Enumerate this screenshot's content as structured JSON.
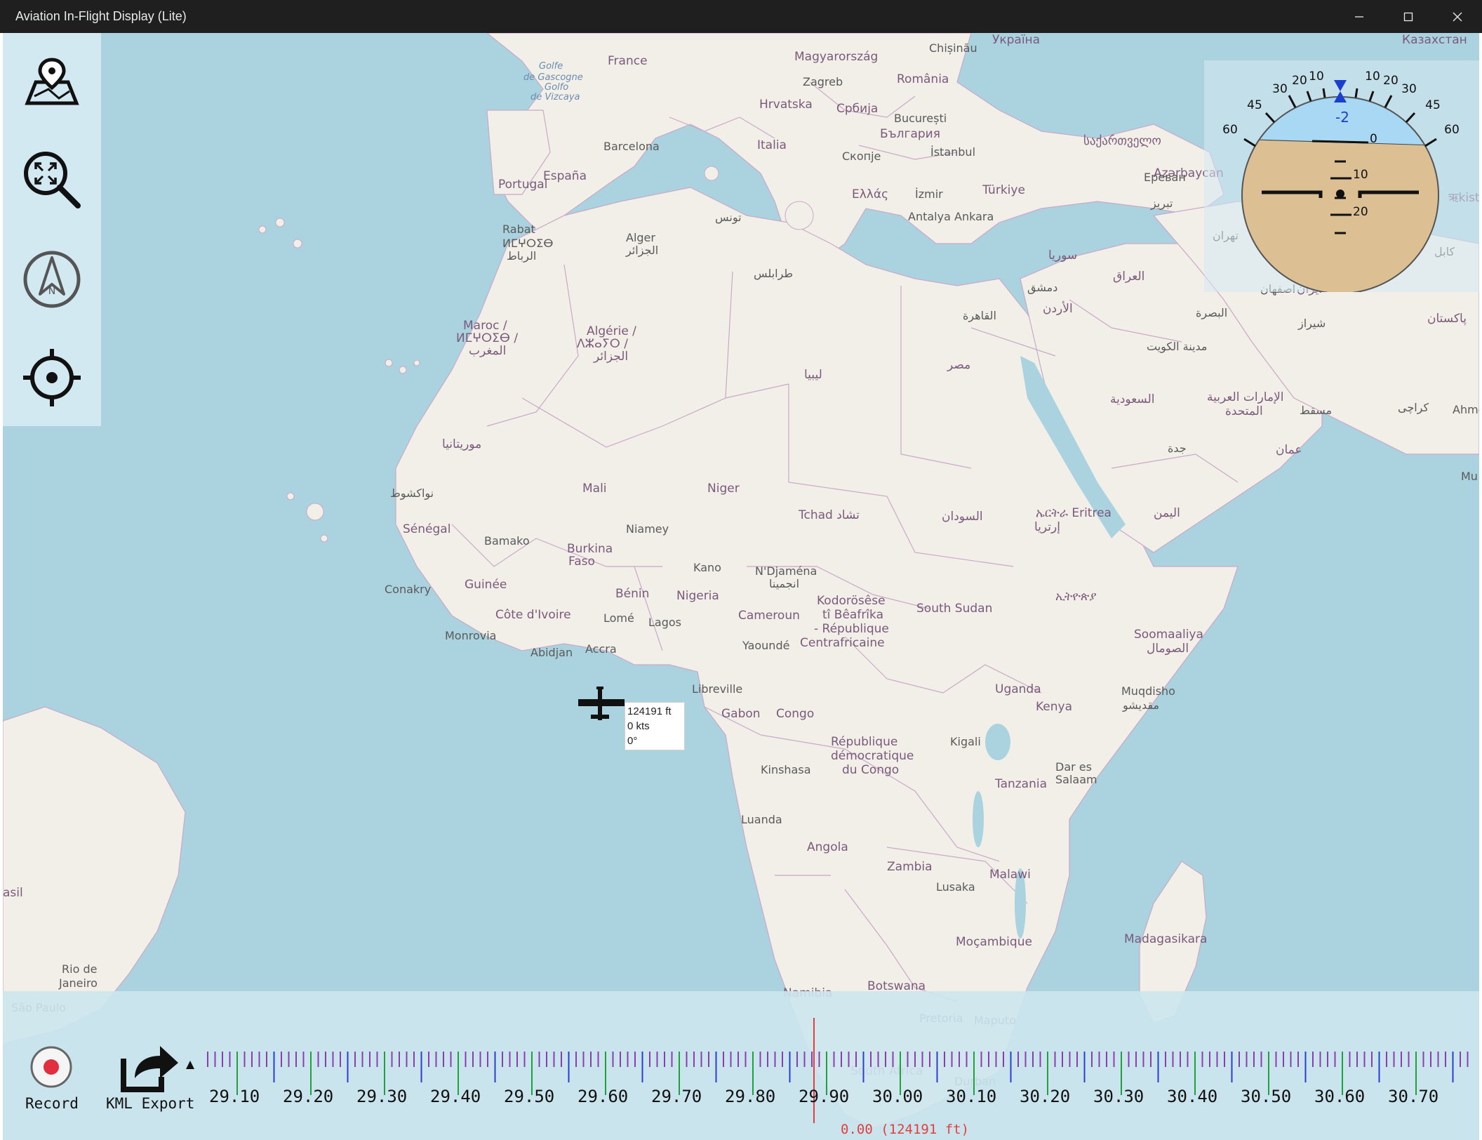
{
  "window": {
    "title": "Aviation In-Flight Display (Lite)",
    "controls": [
      "minimize-icon",
      "maximize-icon",
      "close-icon"
    ]
  },
  "toolbar": {
    "tools": [
      {
        "name": "map-pin-icon"
      },
      {
        "name": "zoom-fit-icon"
      },
      {
        "name": "north-up-icon"
      },
      {
        "name": "center-location-icon"
      }
    ]
  },
  "attitude": {
    "bank_scale": [
      "60",
      "45",
      "30",
      "20",
      "10",
      "10",
      "20",
      "30",
      "45",
      "60"
    ],
    "roll_readout": "-2",
    "pitch_labels": [
      "0",
      "10",
      "20"
    ],
    "sky_color": "#a9d8f5",
    "ground_color": "#ddbf94"
  },
  "aircraft": {
    "altitude": "124191 ft",
    "speed": "0 kts",
    "heading": "0°"
  },
  "bottom": {
    "record_label": "Record",
    "kml_label": "KML Export",
    "timeline_labels": [
      "29.10",
      "29.20",
      "29.30",
      "29.40",
      "29.50",
      "29.60",
      "29.70",
      "29.80",
      "29.90",
      "30.00",
      "30.10",
      "30.20",
      "30.30",
      "30.40",
      "30.50",
      "30.60",
      "30.70"
    ],
    "current_readout": "0.00 (124191 ft)",
    "record_color": "#e03040",
    "cursor_color": "#e04040"
  },
  "map": {
    "places": [
      {
        "t": "France"
      },
      {
        "t": "Magyarország"
      },
      {
        "t": "România"
      },
      {
        "t": "Zagreb"
      },
      {
        "t": "Chișinău"
      },
      {
        "t": "Україна"
      },
      {
        "t": "Hrvatska"
      },
      {
        "t": "Србија"
      },
      {
        "t": "București"
      },
      {
        "t": "България"
      },
      {
        "t": "Italia"
      },
      {
        "t": "Barcelona"
      },
      {
        "t": "Portugal"
      },
      {
        "t": "España"
      },
      {
        "t": "Скопје"
      },
      {
        "t": "İstanbul"
      },
      {
        "t": "საქართველო"
      },
      {
        "t": "Ελλάς"
      },
      {
        "t": "İzmir"
      },
      {
        "t": "Türkiye"
      },
      {
        "t": "Ankara"
      },
      {
        "t": "Azərbaycan"
      },
      {
        "t": "Antalya"
      },
      {
        "t": "Rabat"
      },
      {
        "t": "ⵍⵎⵖⵔⵉⴱ"
      },
      {
        "t": "الرباط"
      },
      {
        "t": "Alger"
      },
      {
        "t": "الجزائر"
      },
      {
        "t": "تونس"
      },
      {
        "t": "طرابلس"
      },
      {
        "t": "Maroc /"
      },
      {
        "t": "ⵍⵎⵖⵔⵉⴱ /"
      },
      {
        "t": "المغرب"
      },
      {
        "t": "Algérie /"
      },
      {
        "t": "ⴷⵣⴰⵢⵔ /"
      },
      {
        "t": "الجزائر"
      },
      {
        "t": "سوريا"
      },
      {
        "t": "دمشق"
      },
      {
        "t": "العراق"
      },
      {
        "t": "الأردن"
      },
      {
        "t": "القاهرة"
      },
      {
        "t": "مصر"
      },
      {
        "t": "ليبيا"
      },
      {
        "t": "موريتانيا"
      },
      {
        "t": "نواكشوط"
      },
      {
        "t": "Mali"
      },
      {
        "t": "Niger"
      },
      {
        "t": "Tchad تشاد"
      },
      {
        "t": "السودان"
      },
      {
        "t": "ኤርትራ Eritrea"
      },
      {
        "t": "إرتريا"
      },
      {
        "t": "اليمن"
      },
      {
        "t": "السعودية"
      },
      {
        "t": "جدة"
      },
      {
        "t": "Sénégal"
      },
      {
        "t": "Bamako"
      },
      {
        "t": "Niamey"
      },
      {
        "t": "Burkina"
      },
      {
        "t": "Faso"
      },
      {
        "t": "Conakry"
      },
      {
        "t": "Guinée"
      },
      {
        "t": "Kano"
      },
      {
        "t": "N'Djaména"
      },
      {
        "t": "انجمينا"
      },
      {
        "t": "Bénin"
      },
      {
        "t": "Nigeria"
      },
      {
        "t": "Côte d'Ivoire"
      },
      {
        "t": "Lomé"
      },
      {
        "t": "Lagos"
      },
      {
        "t": "Cameroun"
      },
      {
        "t": "Kodorösêse"
      },
      {
        "t": "tî Bêafrîka"
      },
      {
        "t": "- République"
      },
      {
        "t": "Centrafricaine"
      },
      {
        "t": "South Sudan"
      },
      {
        "t": "ኢትዮጵያ"
      },
      {
        "t": "Monrovia"
      },
      {
        "t": "Abidjan"
      },
      {
        "t": "Accra"
      },
      {
        "t": "Yaoundé"
      },
      {
        "t": "Soomaaliya"
      },
      {
        "t": "الصومال"
      },
      {
        "t": "Libreville"
      },
      {
        "t": "Gabon"
      },
      {
        "t": "Congo"
      },
      {
        "t": "Uganda"
      },
      {
        "t": "Kenya"
      },
      {
        "t": "Muqdisho"
      },
      {
        "t": "مقديشو"
      },
      {
        "t": "République"
      },
      {
        "t": "démocratique"
      },
      {
        "t": "du Congo"
      },
      {
        "t": "Kigali"
      },
      {
        "t": "Kinshasa"
      },
      {
        "t": "Dar es"
      },
      {
        "t": "Salaam"
      },
      {
        "t": "Tanzania"
      },
      {
        "t": "Luanda"
      },
      {
        "t": "Angola"
      },
      {
        "t": "Zambia"
      },
      {
        "t": "Malawi"
      },
      {
        "t": "Lusaka"
      },
      {
        "t": "Moçambique"
      },
      {
        "t": "Madagasikara"
      },
      {
        "t": "Namibia"
      },
      {
        "t": "Botswana"
      },
      {
        "t": "Pretoria"
      },
      {
        "t": "Maputo"
      },
      {
        "t": "South Africa"
      },
      {
        "t": "Durban"
      },
      {
        "t": "Rio de"
      },
      {
        "t": "Janeiro"
      },
      {
        "t": "São Paulo"
      },
      {
        "t": "asil"
      },
      {
        "t": "Golfe"
      },
      {
        "t": "de Gascogne"
      },
      {
        "t": "Golfo"
      },
      {
        "t": "de Vizcaya"
      },
      {
        "t": "تبریز"
      },
      {
        "t": "تهران"
      },
      {
        "t": "اصفهان"
      },
      {
        "t": "ایران"
      },
      {
        "t": "شیراز"
      },
      {
        "t": "البصرة"
      },
      {
        "t": "مدينة الكويت"
      },
      {
        "t": "الإمارات العربية"
      },
      {
        "t": "المتحدة"
      },
      {
        "t": "مسقط"
      },
      {
        "t": "عمان"
      },
      {
        "t": "كراچی"
      },
      {
        "t": "پاکستان"
      },
      {
        "t": "کابل"
      },
      {
        "t": "Ahme"
      },
      {
        "t": "Mu"
      },
      {
        "t": "Ереван"
      },
      {
        "t": "Казахстан"
      },
      {
        "t": "ऋkistan"
      }
    ]
  }
}
